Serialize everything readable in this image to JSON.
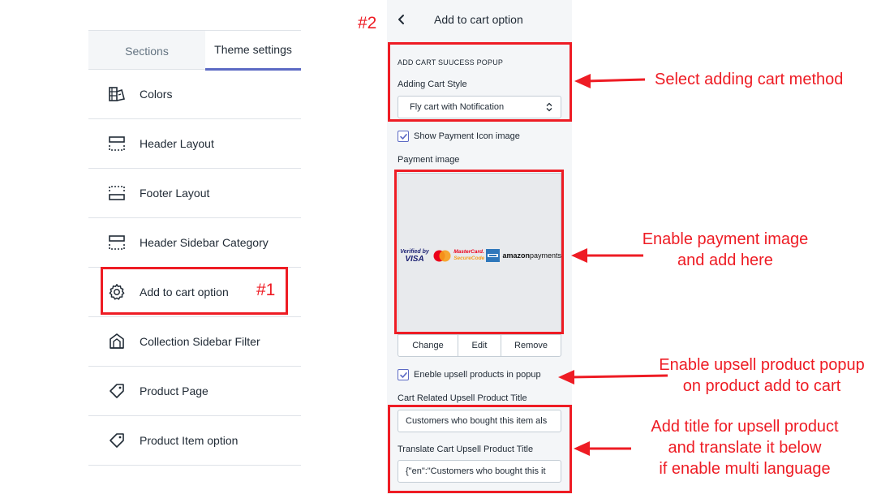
{
  "tabs": {
    "sections": "Sections",
    "theme_settings": "Theme settings"
  },
  "menu": [
    {
      "label": "Colors",
      "icon": "paint-palette-icon"
    },
    {
      "label": "Header Layout",
      "icon": "header-layout-icon"
    },
    {
      "label": "Footer Layout",
      "icon": "footer-layout-icon"
    },
    {
      "label": "Header Sidebar Category",
      "icon": "header-layout-icon"
    },
    {
      "label": "Add to cart option",
      "icon": "gear-icon"
    },
    {
      "label": "Collection Sidebar Filter",
      "icon": "collection-icon"
    },
    {
      "label": "Product Page",
      "icon": "tag-icon"
    },
    {
      "label": "Product Item option",
      "icon": "tag-icon"
    }
  ],
  "panel": {
    "title": "Add to cart option",
    "section_heading": "ADD CART SUUCESS POPUP",
    "adding_cart_style_label": "Adding Cart Style",
    "adding_cart_style_value": "Fly cart with Notification",
    "show_payment_icon_label": "Show Payment Icon image",
    "show_payment_icon_checked": true,
    "payment_image_label": "Payment image",
    "payment_logos": {
      "visa_line1": "Verified by",
      "visa_line2": "VISA",
      "mastercard_line1": "MasterCard.",
      "mastercard_line2": "SecureCode",
      "amazon_bold": "amazon",
      "amazon_rest": "payments"
    },
    "buttons": {
      "change": "Change",
      "edit": "Edit",
      "remove": "Remove"
    },
    "upsell_label": "Eneble upsell products in popup",
    "upsell_checked": true,
    "upsell_title_label": "Cart Related Upsell Product Title",
    "upsell_title_value": "Customers who bought this item als",
    "translate_label": "Translate Cart Upsell Product Title",
    "translate_value": "{\"en\":\"Customers who bought this it"
  },
  "annotations": {
    "step1": "#1",
    "step2": "#2",
    "callout_method": "Select adding cart method",
    "callout_payment_1": "Enable payment image",
    "callout_payment_2": "and add here",
    "callout_upsell_1": "Enable upsell product popup",
    "callout_upsell_2": "on product add to cart",
    "callout_title_1": "Add title for upsell product",
    "callout_title_2": "and translate it below",
    "callout_title_3": "if enable multi language",
    "color": "#ee1c24"
  },
  "colors": {
    "accent": "#5c6ac4",
    "text": "#212b36",
    "muted": "#637381",
    "panel_bg": "#f4f6f8",
    "annotation_red": "#ee1c24"
  }
}
